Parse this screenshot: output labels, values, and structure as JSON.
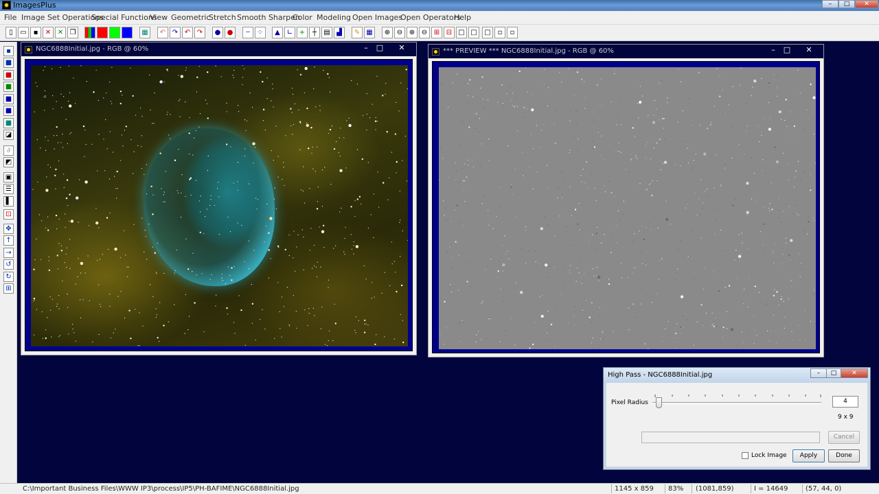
{
  "app": {
    "title": "ImagesPlus",
    "minimize_label": "–",
    "maximize_label": "□",
    "close_label": "✕"
  },
  "menu": {
    "items": [
      "File",
      "Image Set Operations",
      "Special Functions",
      "View",
      "Geometric",
      "Stretch",
      "Smooth Sharpen",
      "Color",
      "Modeling",
      "Open Images",
      "Open Operators",
      "Help"
    ]
  },
  "toolbar": {
    "colors": {
      "red": "#ff0000",
      "green": "#00ff00",
      "blue": "#0000ff"
    }
  },
  "windows": {
    "original": {
      "title": "NGC6888Initial.jpg - RGB @ 60%",
      "minimize_label": "–",
      "maximize_label": "□",
      "close_label": "✕"
    },
    "preview": {
      "title": "*** PREVIEW *** NGC6888Initial.jpg - RGB @ 60%",
      "minimize_label": "–",
      "maximize_label": "□",
      "close_label": "✕"
    }
  },
  "dialog": {
    "title": "High Pass - NGC6888Initial.jpg",
    "pixel_radius_label": "Pixel Radius",
    "pixel_radius_value": "4",
    "kernel_size": "9 x 9",
    "cancel_label": "Cancel",
    "lock_image_label": "Lock Image",
    "apply_label": "Apply",
    "done_label": "Done",
    "min_label": "–",
    "max_label": "□",
    "close_label": "✕"
  },
  "statusbar": {
    "path": "C:\\Important Business Files\\WWW IP3\\process\\IP5\\PH-BAFIME\\NGC6888Initial.jpg",
    "dimensions": "1145 x 859",
    "zoom": "83%",
    "cursor_pos": "(1081,859)",
    "intensity": "I = 14649",
    "rgb": "(57, 44, 0)"
  }
}
